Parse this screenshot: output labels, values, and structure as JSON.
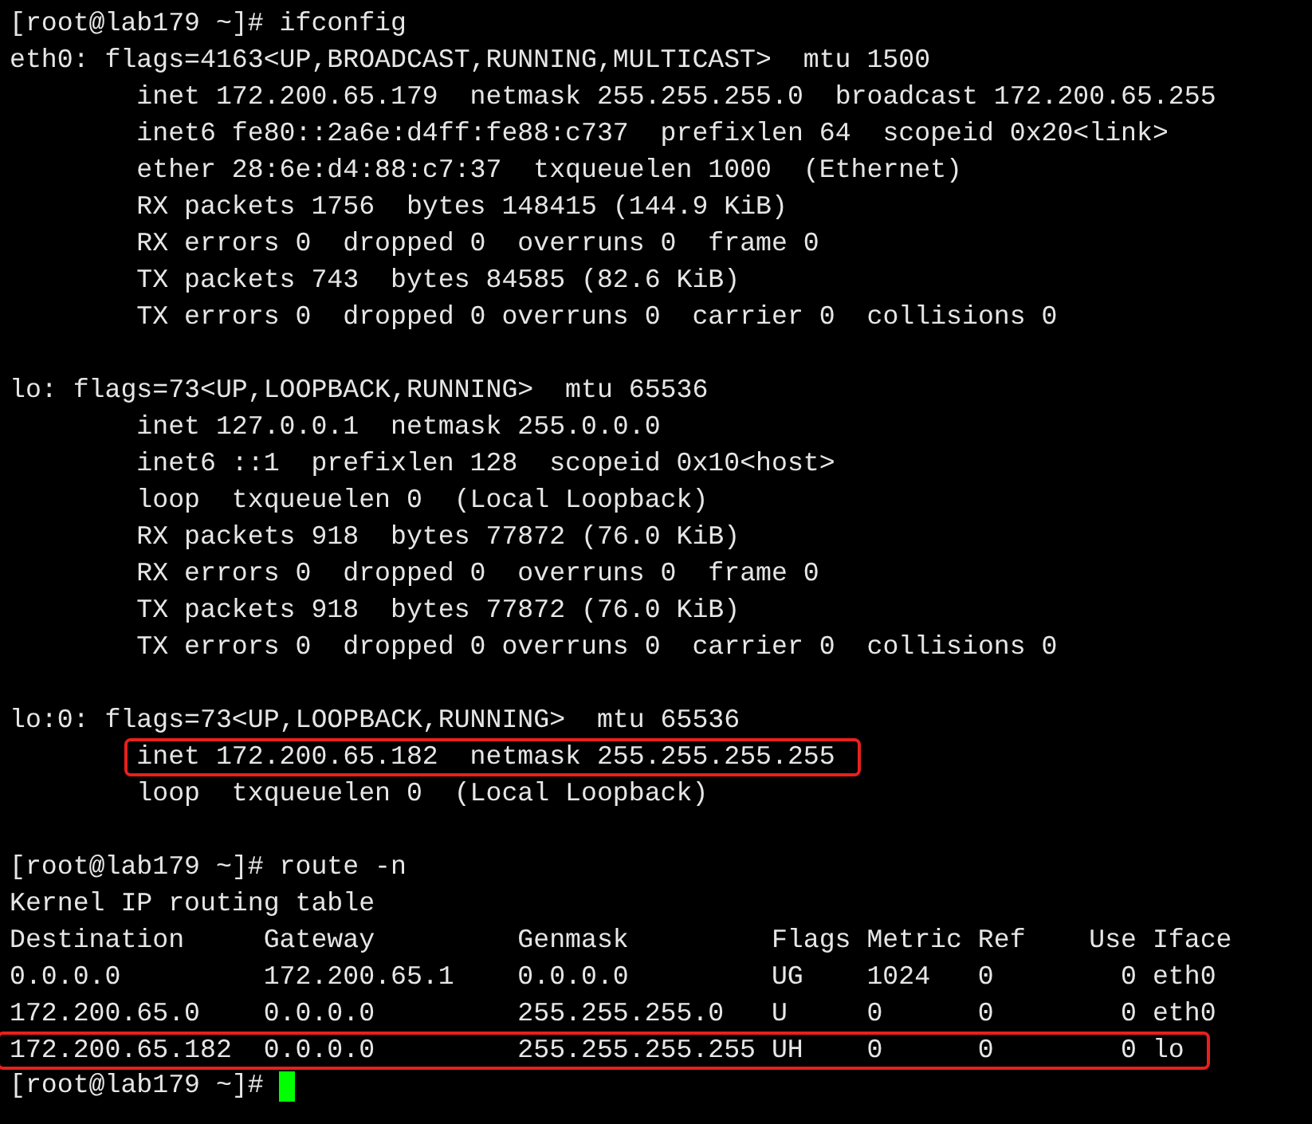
{
  "terminal": {
    "lines": [
      {
        "kind": "text",
        "text": "[root@lab179 ~]# ifconfig",
        "highlighted": false
      },
      {
        "kind": "text",
        "text": "eth0: flags=4163<UP,BROADCAST,RUNNING,MULTICAST>  mtu 1500",
        "highlighted": false
      },
      {
        "kind": "text",
        "text": "        inet 172.200.65.179  netmask 255.255.255.0  broadcast 172.200.65.255",
        "highlighted": false
      },
      {
        "kind": "text",
        "text": "        inet6 fe80::2a6e:d4ff:fe88:c737  prefixlen 64  scopeid 0x20<link>",
        "highlighted": false
      },
      {
        "kind": "text",
        "text": "        ether 28:6e:d4:88:c7:37  txqueuelen 1000  (Ethernet)",
        "highlighted": false
      },
      {
        "kind": "text",
        "text": "        RX packets 1756  bytes 148415 (144.9 KiB)",
        "highlighted": false
      },
      {
        "kind": "text",
        "text": "        RX errors 0  dropped 0  overruns 0  frame 0",
        "highlighted": false
      },
      {
        "kind": "text",
        "text": "        TX packets 743  bytes 84585 (82.6 KiB)",
        "highlighted": false
      },
      {
        "kind": "text",
        "text": "        TX errors 0  dropped 0 overruns 0  carrier 0  collisions 0",
        "highlighted": false
      },
      {
        "kind": "blank"
      },
      {
        "kind": "text",
        "text": "lo: flags=73<UP,LOOPBACK,RUNNING>  mtu 65536",
        "highlighted": false
      },
      {
        "kind": "text",
        "text": "        inet 127.0.0.1  netmask 255.0.0.0",
        "highlighted": false
      },
      {
        "kind": "text",
        "text": "        inet6 ::1  prefixlen 128  scopeid 0x10<host>",
        "highlighted": false
      },
      {
        "kind": "text",
        "text": "        loop  txqueuelen 0  (Local Loopback)",
        "highlighted": false
      },
      {
        "kind": "text",
        "text": "        RX packets 918  bytes 77872 (76.0 KiB)",
        "highlighted": false
      },
      {
        "kind": "text",
        "text": "        RX errors 0  dropped 0  overruns 0  frame 0",
        "highlighted": false
      },
      {
        "kind": "text",
        "text": "        TX packets 918  bytes 77872 (76.0 KiB)",
        "highlighted": false
      },
      {
        "kind": "text",
        "text": "        TX errors 0  dropped 0 overruns 0  carrier 0  collisions 0",
        "highlighted": false
      },
      {
        "kind": "blank"
      },
      {
        "kind": "text",
        "text": "lo:0: flags=73<UP,LOOPBACK,RUNNING>  mtu 65536",
        "highlighted": false
      },
      {
        "kind": "text",
        "text": "        inet 172.200.65.182  netmask 255.255.255.255",
        "highlighted": true
      },
      {
        "kind": "text",
        "text": "        loop  txqueuelen 0  (Local Loopback)",
        "highlighted": false
      },
      {
        "kind": "blank"
      },
      {
        "kind": "text",
        "text": "[root@lab179 ~]# route -n",
        "highlighted": false
      },
      {
        "kind": "text",
        "text": "Kernel IP routing table",
        "highlighted": false
      },
      {
        "kind": "text",
        "text": "Destination     Gateway         Genmask         Flags Metric Ref    Use Iface",
        "highlighted": false
      },
      {
        "kind": "text",
        "text": "0.0.0.0         172.200.65.1    0.0.0.0         UG    1024   0        0 eth0",
        "highlighted": false
      },
      {
        "kind": "text",
        "text": "172.200.65.0    0.0.0.0         255.255.255.0   U     0      0        0 eth0",
        "highlighted": false
      },
      {
        "kind": "text",
        "text": "172.200.65.182  0.0.0.0         255.255.255.255 UH    0      0        0 lo",
        "highlighted": true
      },
      {
        "kind": "prompt",
        "text": "[root@lab179 ~]# ",
        "cursor": true
      }
    ]
  }
}
